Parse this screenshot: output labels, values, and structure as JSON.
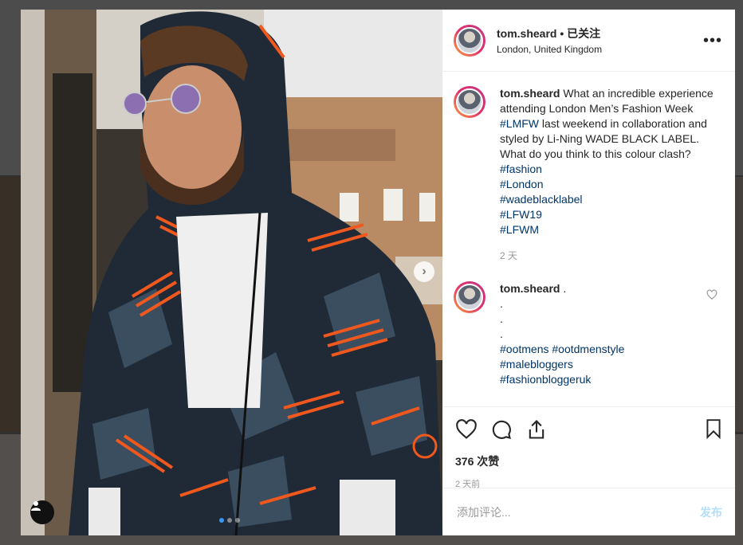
{
  "post": {
    "username": "tom.sheard",
    "separator": " • ",
    "follow_label": "已关注",
    "location": "London, United Kingdom",
    "more_icon": "ellipsis-icon",
    "pagination": {
      "current": 1,
      "total": 3
    }
  },
  "caption": {
    "username": "tom.sheard",
    "text_before": " What an incredible experience attending London Men’s Fashion Week ",
    "inline_tag": "#LMFW",
    "text_after": " last weekend in collaboration and styled by Li-Ning WADE BLACK LABEL. What do you think to this colour clash?",
    "hashtags": [
      "#fashion",
      "#London",
      "#wadeblacklabel",
      "#LFW19",
      "#LFWM"
    ],
    "time": "2 天"
  },
  "comment": {
    "username": "tom.sheard",
    "text": " .",
    "dots": [
      ".",
      ".",
      "."
    ],
    "tag_line1": [
      "#ootmens",
      "#ootdmenstyle"
    ],
    "tags": [
      "#malebloggers",
      "#fashionbloggeruk"
    ]
  },
  "actions": {
    "likes": "376 次赞",
    "time": "2 天前"
  },
  "add_comment": {
    "placeholder": "添加评论...",
    "post_label": "发布"
  },
  "colors": {
    "accent_blue": "#3897f0",
    "hashtag": "#003569",
    "post_disabled": "#b2dffc"
  }
}
